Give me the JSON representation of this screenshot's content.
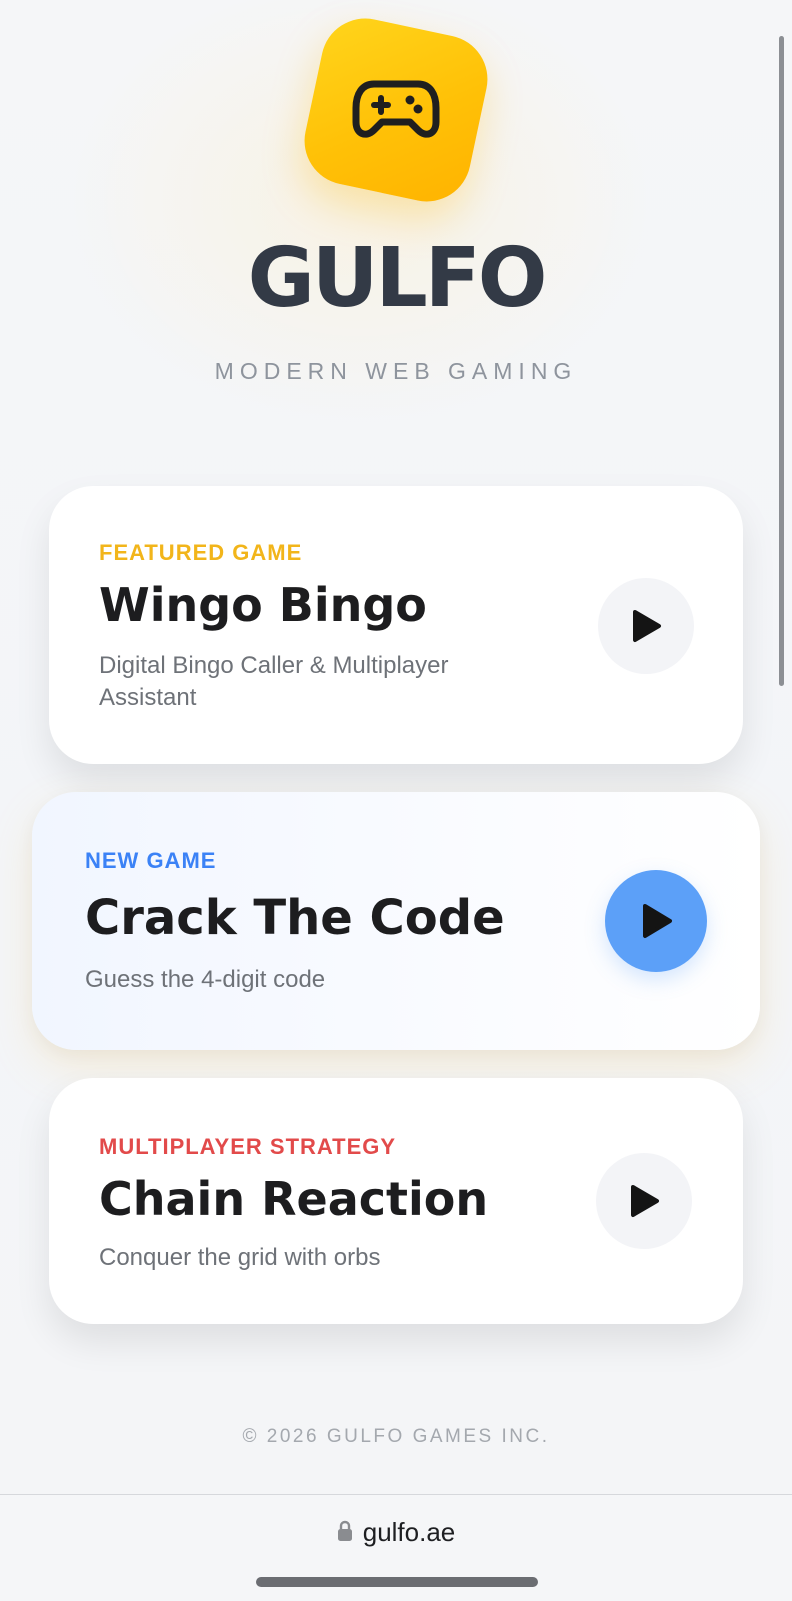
{
  "brand": {
    "title": "GULFO",
    "subtitle": "MODERN WEB GAMING",
    "logo_icon": "gamepad-icon"
  },
  "games": [
    {
      "tag": "FEATURED GAME",
      "tag_color": "#f2b51a",
      "title": "Wingo Bingo",
      "description": "Digital Bingo Caller & Multiplayer Assistant",
      "action_icon": "play-icon"
    },
    {
      "tag": "NEW GAME",
      "tag_color": "#3b82f6",
      "title": "Crack The Code",
      "description": "Guess the 4-digit code",
      "action_icon": "play-icon",
      "button_color": "#5ca0f8"
    },
    {
      "tag": "MULTIPLAYER STRATEGY",
      "tag_color": "#e24a4a",
      "title": "Chain Reaction",
      "description": "Conquer the grid with orbs",
      "action_icon": "play-icon"
    }
  ],
  "footer": {
    "copyright": "© 2026 GULFO GAMES INC."
  },
  "browser": {
    "url": "gulfo.ae",
    "url_icon": "lock-icon"
  },
  "colors": {
    "brand_yellow": "#ffc107",
    "title_dark": "#333a46",
    "accent_blue": "#5ca0f8"
  }
}
